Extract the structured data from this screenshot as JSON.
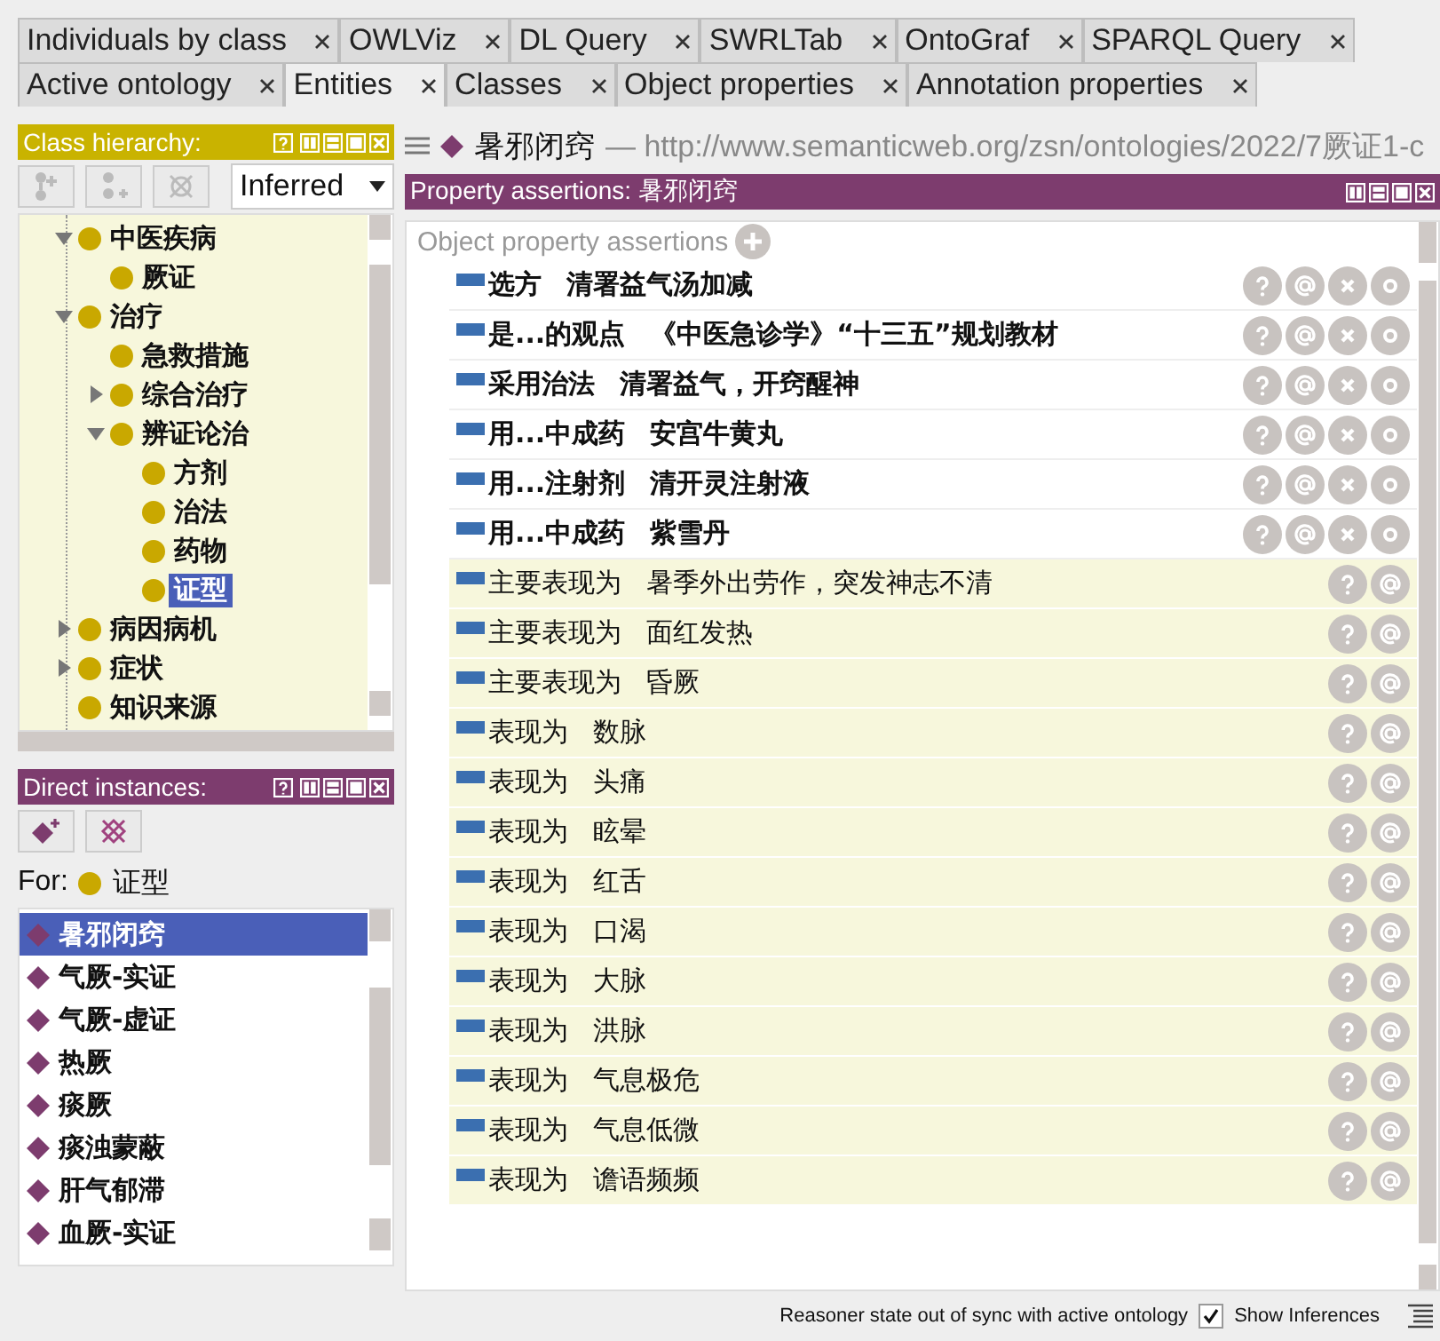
{
  "tab_rows": [
    [
      {
        "label": "Individuals by class",
        "selected": false
      },
      {
        "label": "OWLViz",
        "selected": false
      },
      {
        "label": "DL Query",
        "selected": false
      },
      {
        "label": "SWRLTab",
        "selected": false
      },
      {
        "label": "OntoGraf",
        "selected": false
      },
      {
        "label": "SPARQL Query",
        "selected": false
      }
    ],
    [
      {
        "label": "Active ontology",
        "selected": false
      },
      {
        "label": "Entities",
        "selected": true
      },
      {
        "label": "Classes",
        "selected": false
      },
      {
        "label": "Object properties",
        "selected": false
      },
      {
        "label": "Annotation properties",
        "selected": false
      }
    ]
  ],
  "class_hierarchy": {
    "title": "Class hierarchy:",
    "reasoner_mode": "Inferred",
    "tree": [
      {
        "label": "中医疾病",
        "expanded": true,
        "selected": false,
        "children": [
          {
            "label": "厥证",
            "selected": false
          }
        ]
      },
      {
        "label": "治疗",
        "expanded": true,
        "selected": false,
        "children": [
          {
            "label": "急救措施",
            "selected": false
          },
          {
            "label": "综合治疗",
            "expanded": false,
            "selected": false
          },
          {
            "label": "辨证论治",
            "expanded": true,
            "selected": false,
            "children": [
              {
                "label": "方剂",
                "selected": false
              },
              {
                "label": "治法",
                "selected": false
              },
              {
                "label": "药物",
                "selected": false
              },
              {
                "label": "证型",
                "selected": true
              }
            ]
          }
        ]
      },
      {
        "label": "病因病机",
        "expanded": false,
        "selected": false
      },
      {
        "label": "症状",
        "expanded": false,
        "selected": false
      },
      {
        "label": "知识来源",
        "selected": false
      }
    ]
  },
  "direct_instances": {
    "title": "Direct instances:",
    "for_label": "For:",
    "for_class": "证型",
    "items": [
      {
        "label": "暑邪闭窍",
        "selected": true
      },
      {
        "label": "气厥-实证",
        "selected": false
      },
      {
        "label": "气厥-虚证",
        "selected": false
      },
      {
        "label": "热厥",
        "selected": false
      },
      {
        "label": "痰厥",
        "selected": false
      },
      {
        "label": "痰浊蒙蔽",
        "selected": false
      },
      {
        "label": "肝气郁滞",
        "selected": false
      },
      {
        "label": "血厥-实证",
        "selected": false
      }
    ]
  },
  "entity": {
    "name": "暑邪闭窍",
    "iri": "— http://www.semanticweb.org/zsn/ontologies/2022/7厥证1-c"
  },
  "property_assertions": {
    "title": "Property assertions: 暑邪闭窍",
    "section": "Object property assertions",
    "rows": [
      {
        "kind": "asserted",
        "property": "选方",
        "value": "清署益气汤加减"
      },
      {
        "kind": "asserted",
        "property": "是...的观点",
        "value": "《中医急诊学》“十三五”规划教材"
      },
      {
        "kind": "asserted",
        "property": "采用治法",
        "value": "清署益气，开窍醒神"
      },
      {
        "kind": "asserted",
        "property": "用...中成药",
        "value": "安宫牛黄丸"
      },
      {
        "kind": "asserted",
        "property": "用...注射剂",
        "value": "清开灵注射液"
      },
      {
        "kind": "asserted",
        "property": "用...中成药",
        "value": "紫雪丹"
      },
      {
        "kind": "inferred",
        "property": "主要表现为",
        "value": "暑季外出劳作，突发神志不清"
      },
      {
        "kind": "inferred",
        "property": "主要表现为",
        "value": "面红发热"
      },
      {
        "kind": "inferred",
        "property": "主要表现为",
        "value": "昏厥"
      },
      {
        "kind": "inferred",
        "property": "表现为",
        "value": "数脉"
      },
      {
        "kind": "inferred",
        "property": "表现为",
        "value": "头痛"
      },
      {
        "kind": "inferred",
        "property": "表现为",
        "value": "眩晕"
      },
      {
        "kind": "inferred",
        "property": "表现为",
        "value": "红舌"
      },
      {
        "kind": "inferred",
        "property": "表现为",
        "value": "口渴"
      },
      {
        "kind": "inferred",
        "property": "表现为",
        "value": "大脉"
      },
      {
        "kind": "inferred",
        "property": "表现为",
        "value": "洪脉"
      },
      {
        "kind": "inferred",
        "property": "表现为",
        "value": "气息极危"
      },
      {
        "kind": "inferred",
        "property": "表现为",
        "value": "气息低微"
      },
      {
        "kind": "inferred",
        "property": "表现为",
        "value": "谵语频频"
      }
    ]
  },
  "status_bar": {
    "message": "Reasoner state out of sync with active ontology",
    "show_inferences": {
      "label": "Show Inferences",
      "checked": true
    }
  }
}
